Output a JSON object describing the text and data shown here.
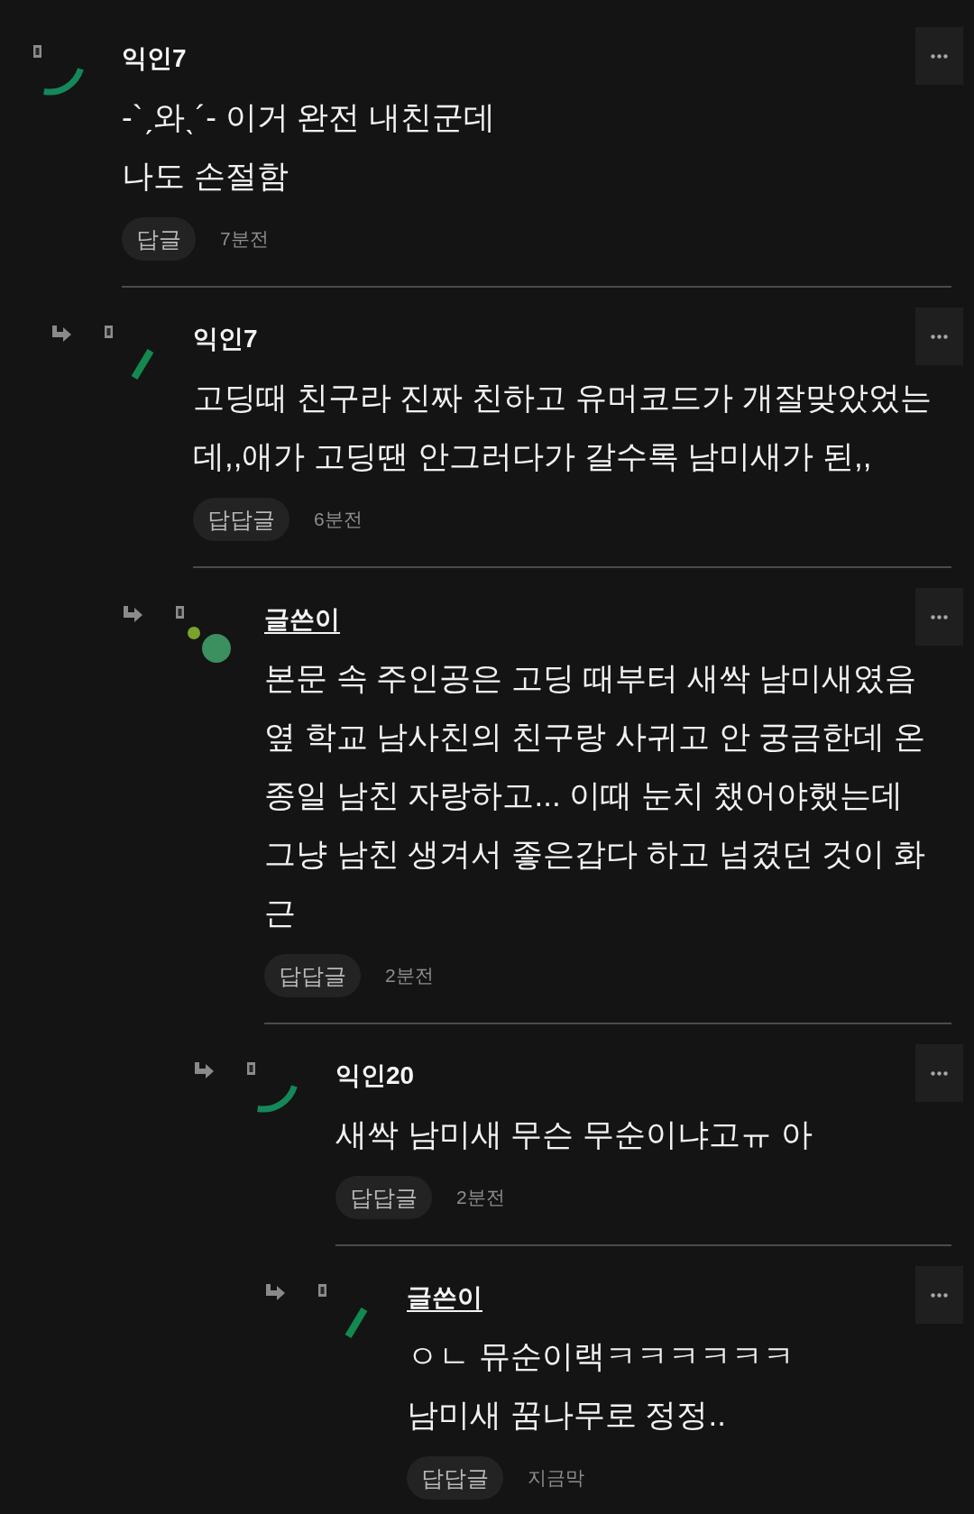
{
  "comments": [
    {
      "author": "익인7",
      "is_writer": false,
      "avatar": {
        "kind": "arc"
      },
      "text": "-`ˏ와ˎ´- 이거 완전 내친군데\n나도 손절함",
      "reply_label": "답글",
      "time": "7분전",
      "children": [
        {
          "author": "익인7",
          "is_writer": false,
          "avatar": {
            "kind": "bar"
          },
          "text": "고딩때 친구라 진짜 친하고 유머코드가 개잘맞았었는\n데,,애가 고딩땐 안그러다가 갈수록 남미새가 된,,",
          "reply_label": "답답글",
          "time": "6분전",
          "children": [
            {
              "author": "글쓴이",
              "is_writer": true,
              "avatar": {
                "kind": "dots"
              },
              "text": "본문 속 주인공은 고딩 때부터 새싹 남미새였음\n옆 학교 남사친의 친구랑 사귀고 안 궁금한데 온\n종일 남친 자랑하고... 이때 눈치 챘어야했는데\n그냥 남친 생겨서 좋은갑다 하고 넘겼던 것이 화\n근",
              "reply_label": "답답글",
              "time": "2분전",
              "children": [
                {
                  "author": "익인20",
                  "is_writer": false,
                  "avatar": {
                    "kind": "arc"
                  },
                  "text": "새싹 남미새 무슨 무순이냐고ㅠ 아",
                  "reply_label": "답답글",
                  "time": "2분전",
                  "children": [
                    {
                      "author": "글쓴이",
                      "is_writer": true,
                      "avatar": {
                        "kind": "bar"
                      },
                      "text": "ㅇㄴ 뮤순이랙ㅋㅋㅋㅋㅋㅋ\n남미새 꿈나무로 정정..",
                      "reply_label": "답답글",
                      "time": "지금막"
                    }
                  ]
                }
              ]
            }
          ]
        }
      ]
    }
  ]
}
